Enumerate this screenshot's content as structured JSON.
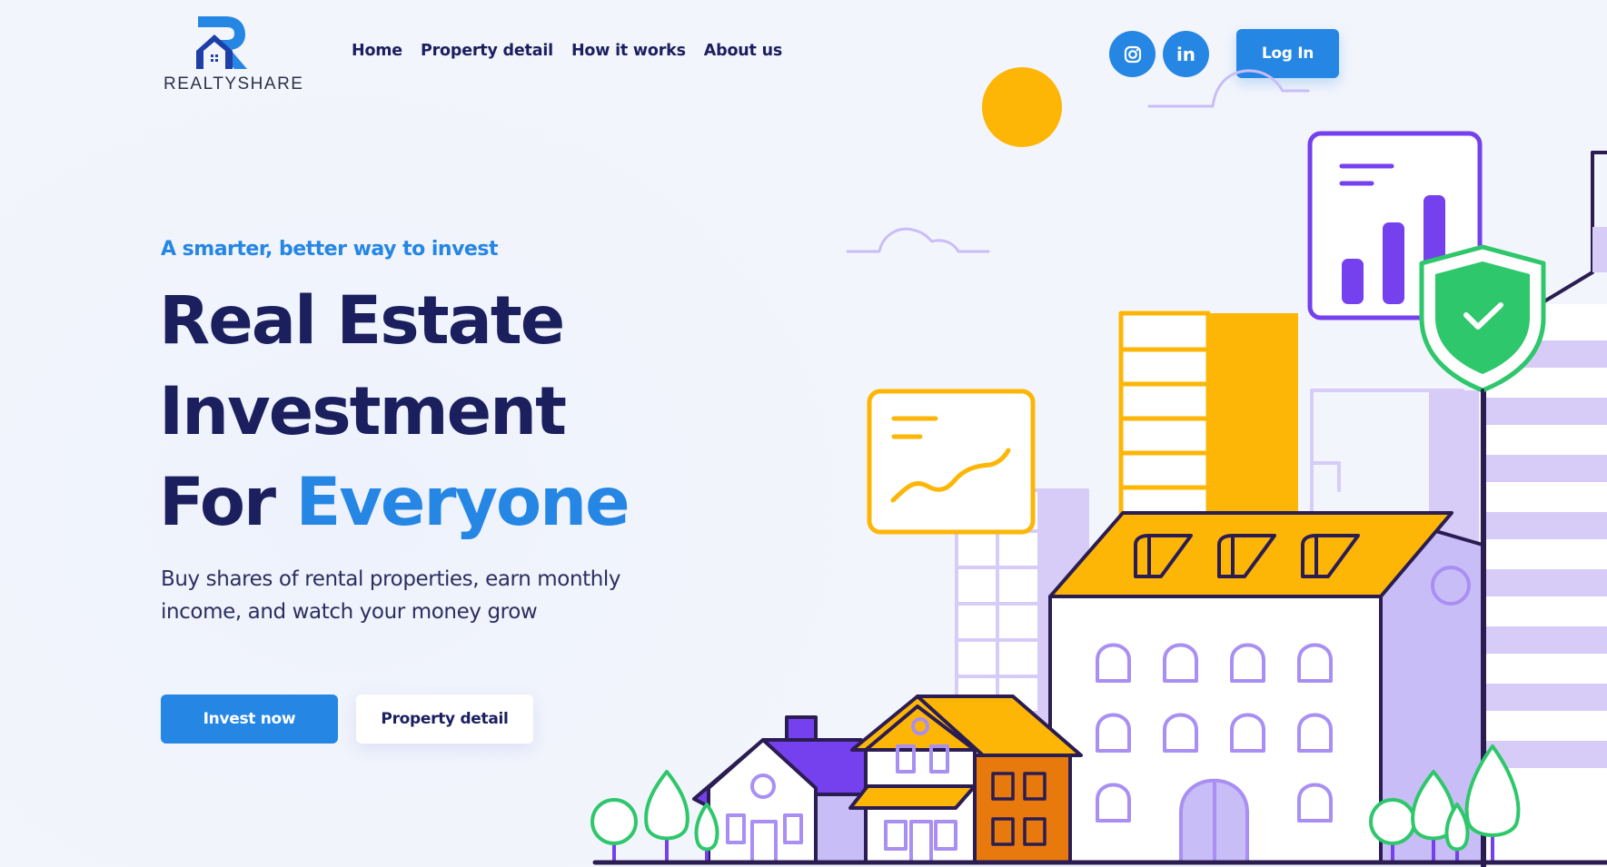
{
  "brand": {
    "name": "REALTYSHARE",
    "color_primary": "#2586e4",
    "color_dark": "#1b1f5e"
  },
  "nav": {
    "items": [
      {
        "label": "Home"
      },
      {
        "label": "Property detail"
      },
      {
        "label": "How it works"
      },
      {
        "label": "About us"
      }
    ]
  },
  "header": {
    "social": [
      {
        "icon": "instagram-icon"
      },
      {
        "icon": "linkedin-icon",
        "glyph": "in"
      }
    ],
    "login_label": "Log In"
  },
  "hero": {
    "tagline": "A smarter, better way to invest",
    "headline_line1": "Real Estate",
    "headline_line2": "Investment",
    "headline_line3_prefix": "For ",
    "headline_line3_accent": "Everyone",
    "subtext": "Buy shares of rental properties, earn monthly income, and watch your money grow",
    "cta_primary": "Invest now",
    "cta_secondary": "Property detail"
  },
  "illustration": {
    "colors": {
      "yellow": "#fdb606",
      "purple": "#7540ee",
      "lavender": "#c9bdf7",
      "green": "#2ec76b",
      "orange": "#e8790d",
      "outline": "#2b1d52"
    }
  }
}
